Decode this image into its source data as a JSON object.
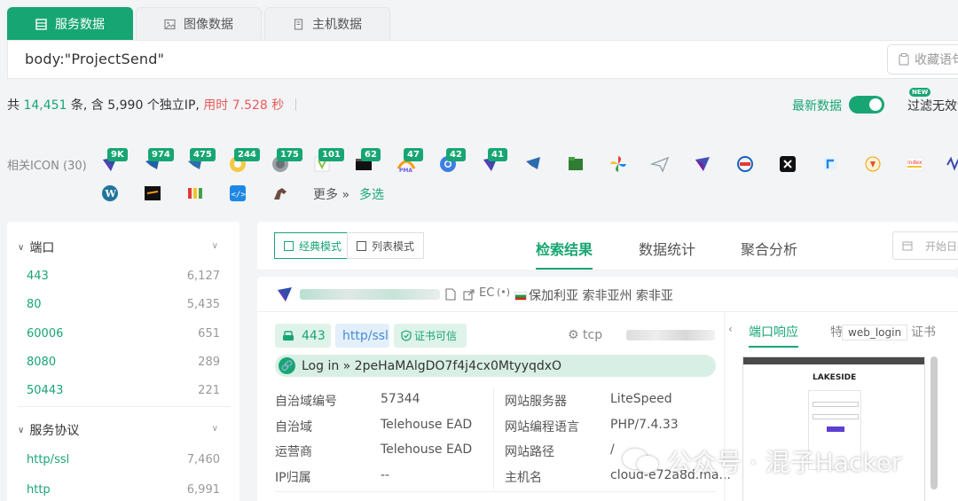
{
  "tabs": [
    {
      "label": "服务数据",
      "icon": "list-icon",
      "active": true
    },
    {
      "label": "图像数据",
      "icon": "image-icon",
      "active": false
    },
    {
      "label": "主机数据",
      "icon": "server-icon",
      "active": false
    }
  ],
  "search": {
    "query": "body:\"ProjectSend\"",
    "favorite_label": "收藏语句"
  },
  "stats": {
    "prefix": "共",
    "total": "14,451",
    "unit1": "条, 含",
    "ips": "5,990",
    "unit2": "个独立IP,",
    "time_label": "用时 7.528 秒"
  },
  "latest": {
    "label": "最新数据",
    "on": true
  },
  "filter": {
    "badge": "NEW",
    "label": "过滤无效请求"
  },
  "icons": {
    "label": "相关ICON (30)",
    "counts": [
      "9K",
      "974",
      "475",
      "244",
      "175",
      "101",
      "62",
      "47",
      "42",
      "41"
    ],
    "more_label": "更多",
    "multi_label": "多选"
  },
  "sidebar": {
    "port_section": {
      "title": "端口",
      "items": [
        {
          "key": "443",
          "value": "6,127"
        },
        {
          "key": "80",
          "value": "5,435"
        },
        {
          "key": "60006",
          "value": "651"
        },
        {
          "key": "8080",
          "value": "289"
        },
        {
          "key": "50443",
          "value": "221"
        }
      ]
    },
    "protocol_section": {
      "title": "服务协议",
      "items": [
        {
          "key": "http/ssl",
          "value": "7,460"
        },
        {
          "key": "http",
          "value": "6,991"
        }
      ]
    }
  },
  "main": {
    "modes": [
      "经典模式",
      "列表模式"
    ],
    "view_tabs": [
      "检索结果",
      "数据统计",
      "聚合分析"
    ],
    "date_placeholder": "开始日期"
  },
  "result": {
    "location": "保加利亚 索非亚州 索非亚",
    "ec_label": "EC",
    "port": "443",
    "protocol": "http/ssl",
    "cert_label": "证书可信",
    "transport": "tcp",
    "login_text": "Log in » 2peHaMAlgDO7f4j4cx0MtyyqdxO",
    "fields_left": [
      {
        "label": "自治域编号",
        "value": "57344"
      },
      {
        "label": "自治域",
        "value": "Telehouse EAD"
      },
      {
        "label": "运营商",
        "value": "Telehouse EAD"
      },
      {
        "label": "IP归属",
        "value": "--"
      }
    ],
    "fields_right": [
      {
        "label": "网站服务器",
        "value": "LiteSpeed"
      },
      {
        "label": "网站编程语言",
        "value": "PHP/7.4.33"
      },
      {
        "label": "网站路径",
        "value": "/"
      },
      {
        "label": "主机名",
        "value": "cloud-e72a8d.ma..."
      }
    ],
    "right_tabs": [
      "端口响应",
      "特征推荐",
      "证书"
    ],
    "preview_label": "web_login",
    "preview_brand": "LAKESIDE"
  },
  "watermark": "公众号 · 混子Hacker",
  "colors": {
    "accent": "#17a673",
    "red": "#e85b5b",
    "blue": "#4a8bd6"
  }
}
